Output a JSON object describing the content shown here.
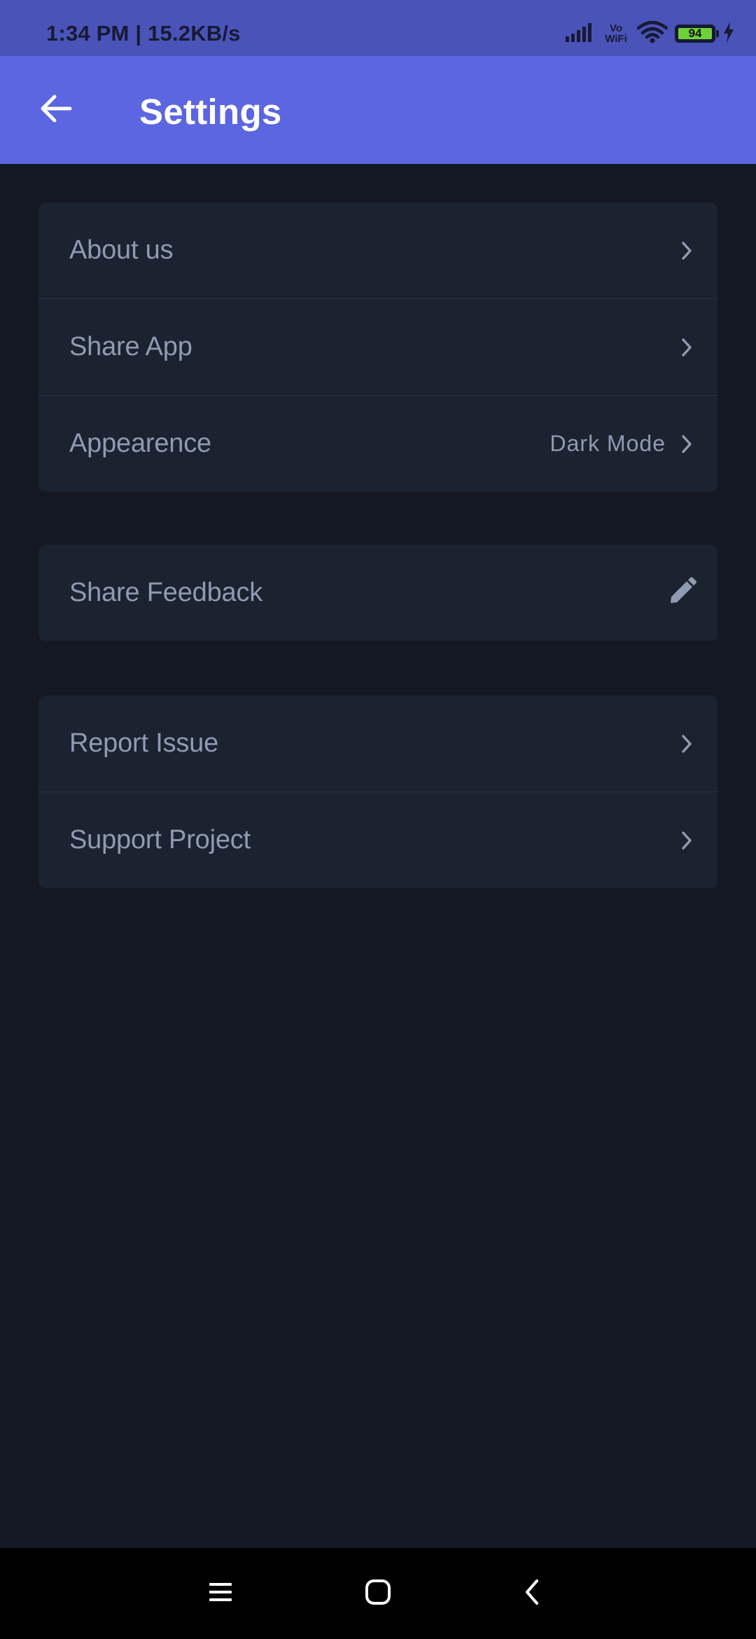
{
  "status_bar": {
    "time": "1:34 PM | 15.2KB/s",
    "vowifi_top": "Vo",
    "vowifi_bottom": "WiFi",
    "battery_level": "94",
    "icons": [
      "signal-icon",
      "vowifi-icon",
      "wifi-icon",
      "battery-icon",
      "charging-icon"
    ]
  },
  "app_bar": {
    "back_icon": "arrow-left-icon",
    "title": "Settings"
  },
  "groups": [
    {
      "items": [
        {
          "label": "About us",
          "value": "",
          "trailing_icon": "chevron-right-icon"
        },
        {
          "label": "Share App",
          "value": "",
          "trailing_icon": "chevron-right-icon"
        },
        {
          "label": "Appearence",
          "value": "Dark Mode",
          "trailing_icon": "chevron-right-icon"
        }
      ]
    },
    {
      "items": [
        {
          "label": "Share Feedback",
          "value": "",
          "trailing_icon": "pencil-icon"
        }
      ]
    },
    {
      "items": [
        {
          "label": "Report Issue",
          "value": "",
          "trailing_icon": "chevron-right-icon"
        },
        {
          "label": "Support Project",
          "value": "",
          "trailing_icon": "chevron-right-icon"
        }
      ]
    }
  ],
  "nav_bar": {
    "icons": [
      "menu-icon",
      "home-icon",
      "back-chevron-icon"
    ]
  },
  "colors": {
    "status_bar": "#4a53b8",
    "app_bar": "#5b66e0",
    "background": "#141823",
    "card": "#1b2230",
    "text_muted": "#8e9bb2",
    "battery_fill": "#6fd13a"
  }
}
